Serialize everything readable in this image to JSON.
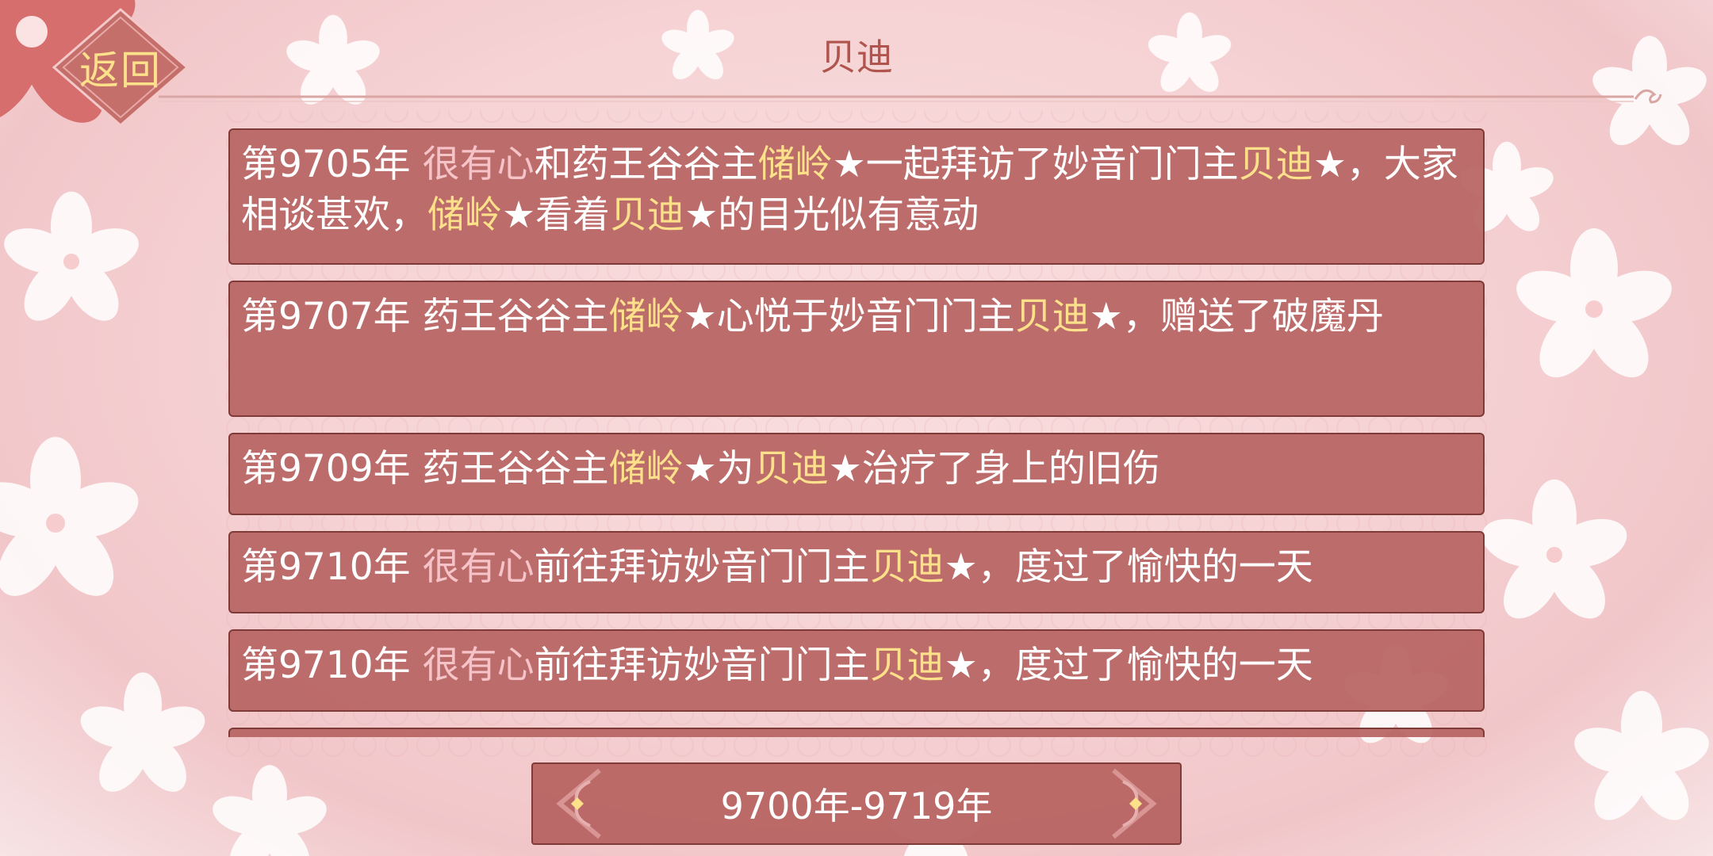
{
  "header": {
    "back_label": "返回",
    "title": "贝迪"
  },
  "records": [
    {
      "year": "第9705年",
      "segments": [
        {
          "text": "很有心",
          "style": "self"
        },
        {
          "text": "和药王谷谷主",
          "style": "plain"
        },
        {
          "text": "储岭",
          "style": "name"
        },
        {
          "text": "★一起拜访了妙音门门主",
          "style": "plain"
        },
        {
          "text": "贝迪",
          "style": "name"
        },
        {
          "text": "★，大家相谈甚欢，",
          "style": "plain"
        },
        {
          "text": "储岭",
          "style": "name"
        },
        {
          "text": "★看着",
          "style": "plain"
        },
        {
          "text": "贝迪",
          "style": "name"
        },
        {
          "text": "★的目光似有意动",
          "style": "plain"
        }
      ]
    },
    {
      "year": "第9707年",
      "segments": [
        {
          "text": "药王谷谷主",
          "style": "plain"
        },
        {
          "text": "储岭",
          "style": "name"
        },
        {
          "text": "★心悦于妙音门门主",
          "style": "plain"
        },
        {
          "text": "贝迪",
          "style": "name"
        },
        {
          "text": "★，赠送了破魔丹",
          "style": "plain"
        }
      ]
    },
    {
      "year": "第9709年",
      "segments": [
        {
          "text": "药王谷谷主",
          "style": "plain"
        },
        {
          "text": "储岭",
          "style": "name"
        },
        {
          "text": "★为",
          "style": "plain"
        },
        {
          "text": "贝迪",
          "style": "name"
        },
        {
          "text": "★治疗了身上的旧伤",
          "style": "plain"
        }
      ]
    },
    {
      "year": "第9710年",
      "segments": [
        {
          "text": "很有心",
          "style": "self"
        },
        {
          "text": "前往拜访妙音门门主",
          "style": "plain"
        },
        {
          "text": "贝迪",
          "style": "name"
        },
        {
          "text": "★，度过了愉快的一天",
          "style": "plain"
        }
      ]
    },
    {
      "year": "第9710年",
      "segments": [
        {
          "text": "很有心",
          "style": "self"
        },
        {
          "text": "前往拜访妙音门门主",
          "style": "plain"
        },
        {
          "text": "贝迪",
          "style": "name"
        },
        {
          "text": "★，度过了愉快的一天",
          "style": "plain"
        }
      ]
    },
    {
      "year": "",
      "segments": []
    }
  ],
  "pager": {
    "range_label": "9700年-9719年",
    "prev_icon": "ornate-left-arrow-icon",
    "next_icon": "ornate-right-arrow-icon"
  },
  "colors": {
    "card_bg": "#b76462",
    "card_border": "#7e3b38",
    "highlight_name": "#fde08a",
    "highlight_self": "#f6c4c8",
    "title_text": "#b0554d"
  }
}
